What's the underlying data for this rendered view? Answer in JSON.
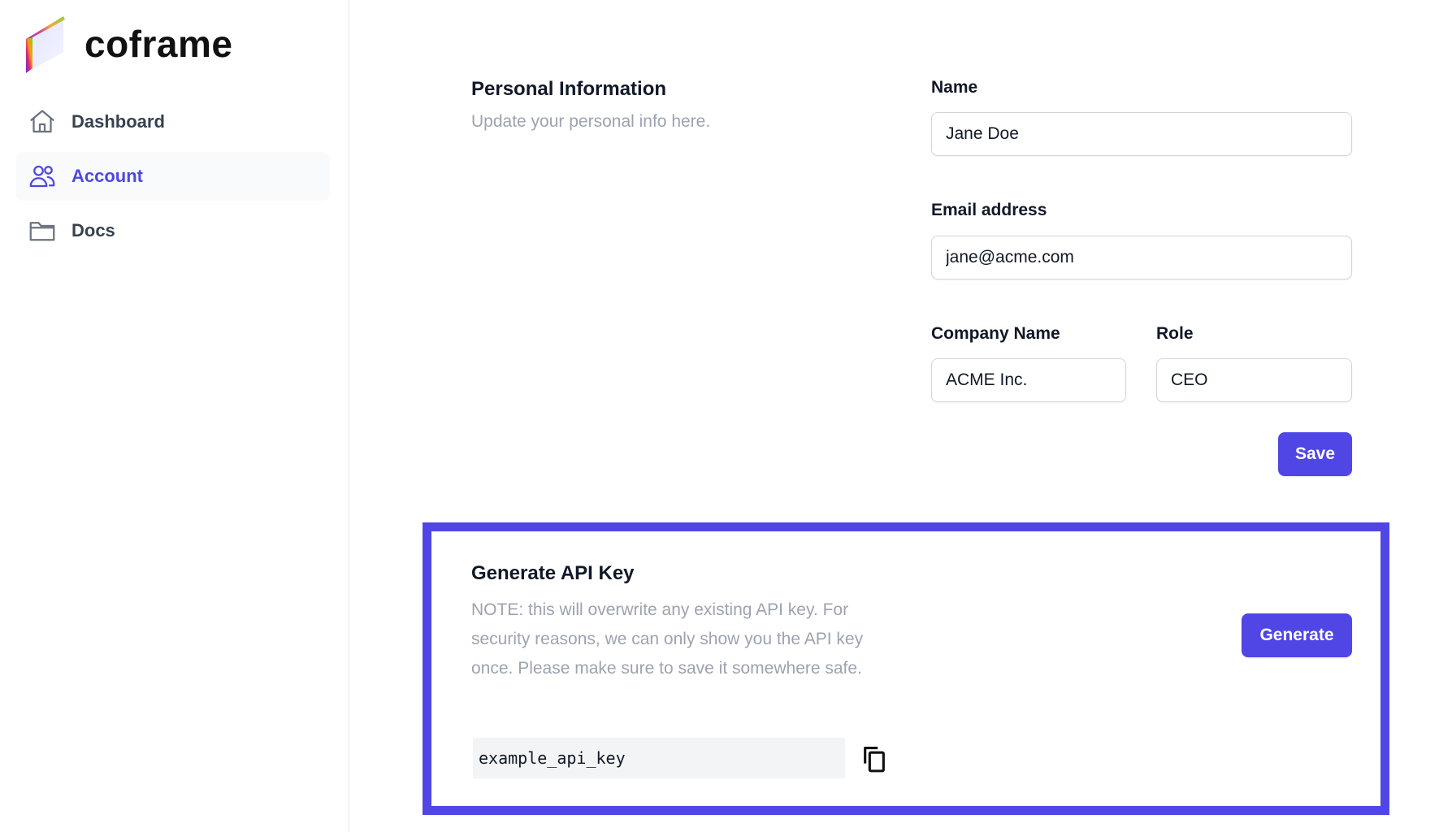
{
  "brand": {
    "name": "coframe"
  },
  "sidebar": {
    "items": [
      {
        "label": "Dashboard",
        "icon": "home-icon",
        "active": false
      },
      {
        "label": "Account",
        "icon": "users-icon",
        "active": true
      },
      {
        "label": "Docs",
        "icon": "folder-icon",
        "active": false
      }
    ]
  },
  "personal": {
    "title": "Personal Information",
    "description": "Update your personal info here.",
    "name_label": "Name",
    "name_value": "Jane Doe",
    "email_label": "Email address",
    "email_value": "jane@acme.com",
    "company_label": "Company Name",
    "company_value": "ACME Inc.",
    "role_label": "Role",
    "role_value": "CEO",
    "save_label": "Save"
  },
  "api": {
    "title": "Generate API Key",
    "note_lines": [
      "NOTE: this will overwrite any existing API key. For",
      "security reasons, we can only show you the API key",
      "once. Please make sure to save it somewhere safe."
    ],
    "generate_label": "Generate",
    "key_value": "example_api_key",
    "copy_icon": "copy-icon"
  },
  "colors": {
    "accent": "#4f46e5",
    "muted_text": "#9ca3af",
    "nav_text": "#374151",
    "border": "#d1d5db"
  }
}
